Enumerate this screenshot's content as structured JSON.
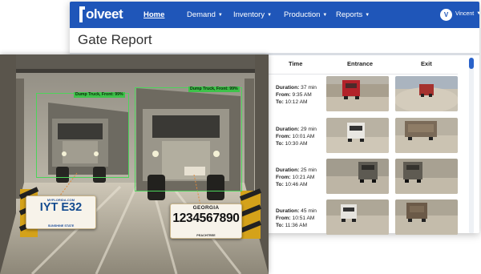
{
  "brand": {
    "name": "olveet"
  },
  "nav": {
    "items": [
      {
        "label": "Home",
        "active": true
      },
      {
        "label": "Demand",
        "caret": "▼"
      },
      {
        "label": "Inventory",
        "caret": "▼"
      },
      {
        "label": "Production",
        "caret": "▼"
      },
      {
        "label": "Reports",
        "caret": "▼"
      }
    ],
    "user_initial": "V",
    "user_name": "Vincent",
    "user_caret": "▼"
  },
  "page": {
    "title": "Gate Report"
  },
  "table": {
    "columns": [
      "Time",
      "Entrance",
      "Exit"
    ],
    "rows": [
      {
        "duration_label": "Duration:",
        "duration": "37 min",
        "from_label": "From:",
        "from": "9:35 AM",
        "to_label": "To:",
        "to": "10:12 AM"
      },
      {
        "duration_label": "Duration:",
        "duration": "29 min",
        "from_label": "From:",
        "from": "10:01 AM",
        "to_label": "To:",
        "to": "10:30 AM"
      },
      {
        "duration_label": "Duration:",
        "duration": "25 min",
        "from_label": "From:",
        "from": "10:21 AM",
        "to_label": "To:",
        "to": "10:46 AM"
      },
      {
        "duration_label": "Duration:",
        "duration": "45 min",
        "from_label": "From:",
        "from": "10:51 AM",
        "to_label": "To:",
        "to": "11:36 AM"
      }
    ]
  },
  "photo": {
    "detections": [
      {
        "label": "Dump Truck, Front: 99%"
      },
      {
        "label": "Dump Truck, Front: 99%"
      }
    ],
    "plates": {
      "florida": {
        "top": "MYFLORIDA.COM",
        "number": "IYT  E32",
        "bottom": "SUNSHINE STATE"
      },
      "georgia": {
        "top": "GEORGIA",
        "number": "1234567890",
        "bottom": "PEACHTREE"
      }
    }
  },
  "colors": {
    "navbar": "#1f56b9",
    "detection": "#3ec24a"
  }
}
